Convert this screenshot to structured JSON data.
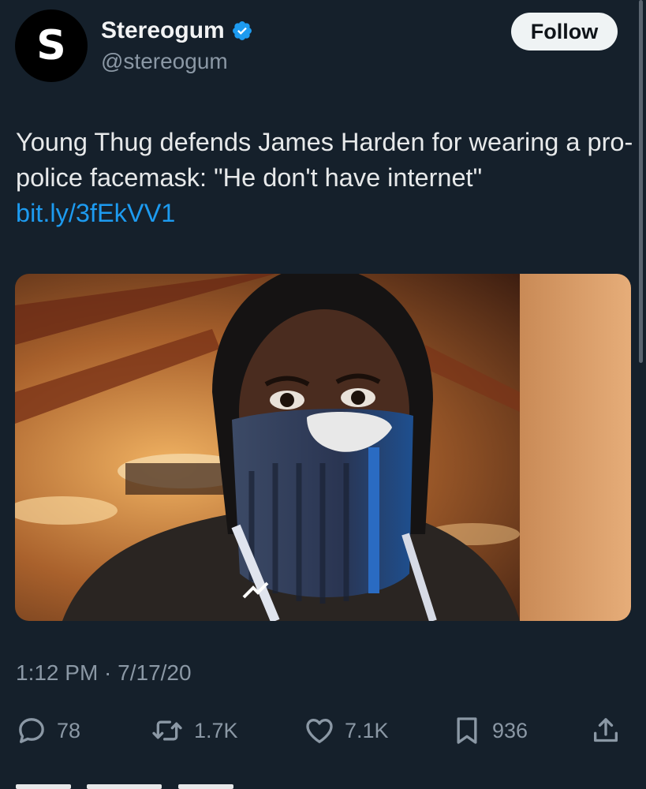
{
  "author": {
    "avatar_letter": "S",
    "display_name": "Stereogum",
    "handle": "@stereogum",
    "verified": true,
    "verified_color": "#1d9bf0"
  },
  "follow_button": {
    "label": "Follow"
  },
  "tweet": {
    "text": "Young Thug defends James Harden for wearing a pro-police facemask: \"He don't have internet\"",
    "link": "bit.ly/3fEkVV1",
    "link_color": "#1d9bf0",
    "timestamp": "1:12 PM · 7/17/20"
  },
  "media": {
    "description_icon": "photo"
  },
  "actions": {
    "replies": "78",
    "retweets": "1.7K",
    "likes": "7.1K",
    "bookmarks": "936",
    "icons": [
      "reply-icon",
      "retweet-icon",
      "like-icon",
      "bookmark-icon",
      "share-icon"
    ]
  },
  "theme": {
    "background": "#15202b",
    "text": "#e7e9ea",
    "secondary_text": "#8b98a5",
    "accent": "#1d9bf0"
  }
}
